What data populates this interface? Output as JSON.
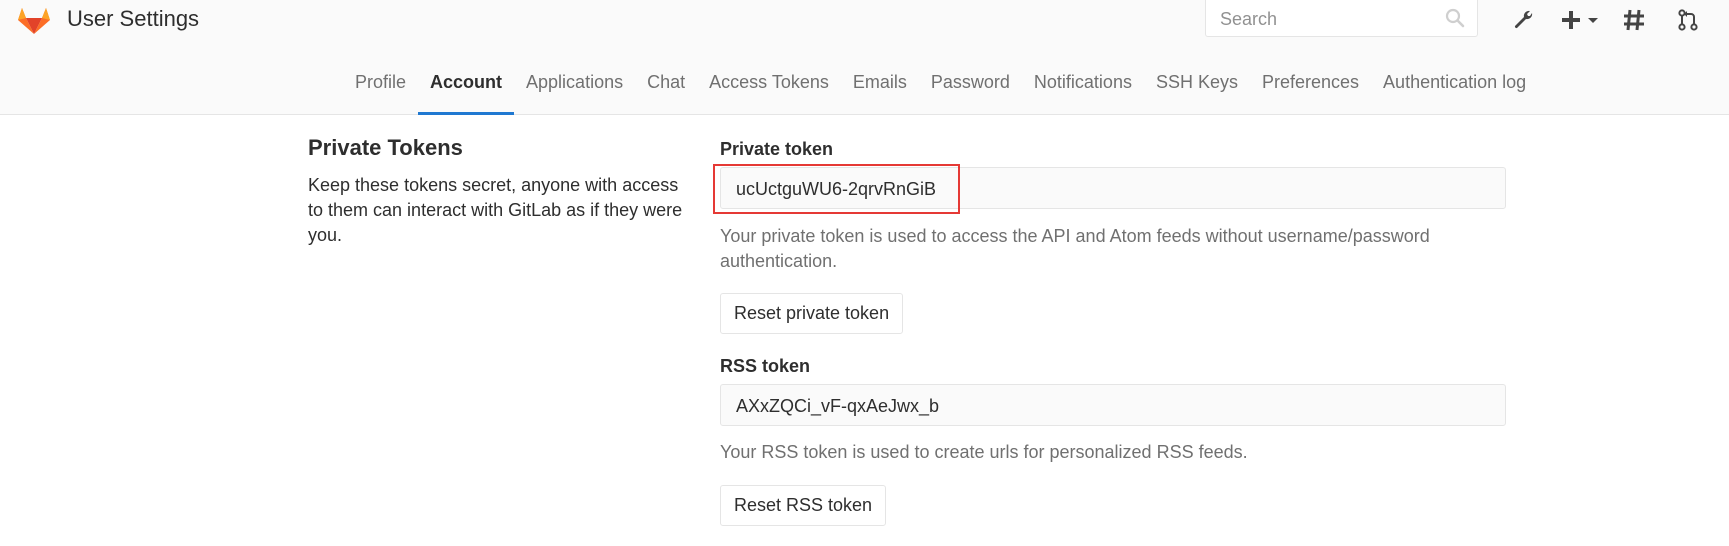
{
  "header": {
    "title": "User Settings",
    "search": {
      "placeholder": "Search",
      "value": ""
    },
    "icons": [
      "gitlab-logo",
      "wrench-icon",
      "plus-icon",
      "chevron-down-icon",
      "hash-icon",
      "merge-request-icon"
    ]
  },
  "tabs": [
    {
      "label": "Profile",
      "active": false
    },
    {
      "label": "Account",
      "active": true
    },
    {
      "label": "Applications",
      "active": false
    },
    {
      "label": "Chat",
      "active": false
    },
    {
      "label": "Access Tokens",
      "active": false
    },
    {
      "label": "Emails",
      "active": false
    },
    {
      "label": "Password",
      "active": false
    },
    {
      "label": "Notifications",
      "active": false
    },
    {
      "label": "SSH Keys",
      "active": false
    },
    {
      "label": "Preferences",
      "active": false
    },
    {
      "label": "Authentication log",
      "active": false
    }
  ],
  "section": {
    "title": "Private Tokens",
    "description": "Keep these tokens secret, anyone with access to them can interact with GitLab as if they were you."
  },
  "private_token": {
    "label": "Private token",
    "value": "ucUctguWU6-2qrvRnGiB",
    "help": "Your private token is used to access the API and Atom feeds without username/password authentication.",
    "reset_label": "Reset private token"
  },
  "rss_token": {
    "label": "RSS token",
    "value": "AXxZQCi_vF-qxAeJwx_b",
    "help": "Your RSS token is used to create urls for personalized RSS feeds.",
    "reset_label": "Reset RSS token"
  },
  "colors": {
    "accent": "#1f78d1",
    "highlight": "#e53935",
    "logo_orange": "#fc6d26",
    "logo_red": "#e24329",
    "logo_light": "#fca326"
  }
}
